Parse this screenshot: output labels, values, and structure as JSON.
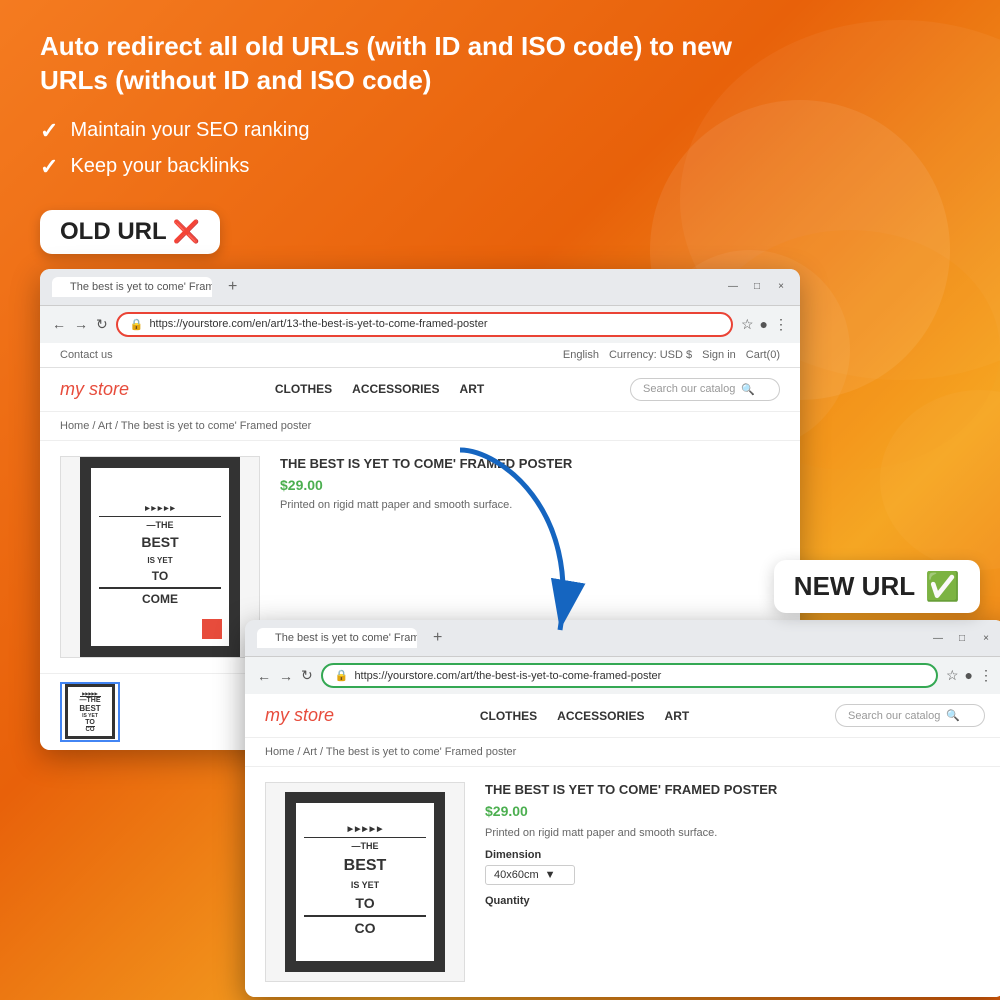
{
  "background": {
    "color": "#f47b20"
  },
  "header": {
    "headline": "Auto redirect all old URLs (with ID and ISO code) to new URLs (without ID and ISO code)",
    "bullets": [
      "Maintain your SEO ranking",
      "Keep your backlinks"
    ]
  },
  "old_url_badge": {
    "label": "OLD URL",
    "icon": "❌"
  },
  "new_url_badge": {
    "label": "NEW URL",
    "icon": "✅"
  },
  "browser_old": {
    "tab_title": "The best is yet to come' Frame...",
    "url": "https://yourstore.com/en/art/13-the-best-is-yet-to-come-framed-poster",
    "url_border": "red",
    "top_bar": {
      "contact": "Contact us",
      "language": "English",
      "currency": "Currency: USD $",
      "signin": "Sign in",
      "cart": "Cart(0)"
    },
    "nav": {
      "logo_text": "my store",
      "menu": [
        "CLOTHES",
        "ACCESSORIES",
        "ART"
      ],
      "search_placeholder": "Search our catalog"
    },
    "breadcrumb": "Home / Art / The best is yet to come' Framed poster",
    "product": {
      "title": "THE BEST IS YET TO COME' FRAMED POSTER",
      "price": "$29.00",
      "description": "Printed on rigid matt paper and smooth surface."
    }
  },
  "browser_new": {
    "tab_title": "The best is yet to come' Frame...",
    "url": "https://yourstore.com/art/the-best-is-yet-to-come-framed-poster",
    "url_border": "green",
    "nav": {
      "logo_text": "my store",
      "menu": [
        "CLOTHES",
        "ACCESSORIES",
        "ART"
      ],
      "search_placeholder": "Search our catalog"
    },
    "breadcrumb": "Home / Art / The best is yet to come' Framed poster",
    "product": {
      "title": "THE BEST IS YET TO COME' FRAMED POSTER",
      "price": "$29.00",
      "description": "Printed on rigid matt paper and smooth surface.",
      "dimension_label": "Dimension",
      "dimension_value": "40x60cm",
      "qty_label": "Quantity"
    }
  },
  "poster": {
    "play_icons": "▶ ▶ ▶ ▶ ▶",
    "line1": "—THE",
    "line2": "BEST",
    "line3": "IS YET",
    "line4": "TO",
    "line5": "CO",
    "line6": "ME"
  }
}
